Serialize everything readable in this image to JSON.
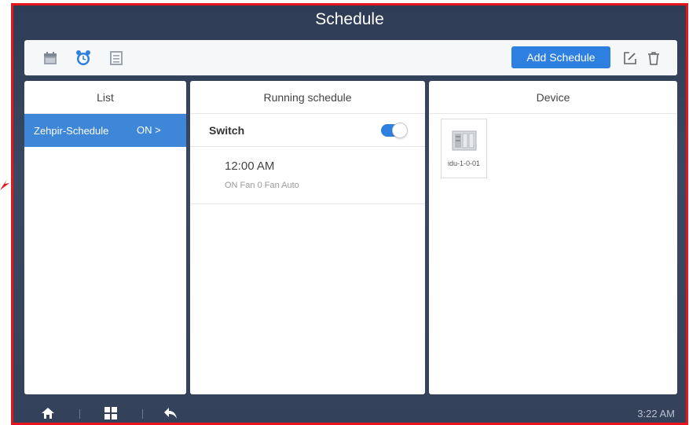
{
  "window": {
    "title": "Schedule"
  },
  "toolbar": {
    "icons": [
      "calendar-icon",
      "alarm-clock-icon",
      "list-icon"
    ],
    "add_schedule_label": "Add Schedule",
    "edit_icon": "edit-icon",
    "delete_icon": "trash-icon"
  },
  "list_panel": {
    "header": "List",
    "items": [
      {
        "name": "Zehpir-Schedule",
        "status": "ON >"
      }
    ]
  },
  "running_panel": {
    "header": "Running schedule",
    "switch_label": "Switch",
    "switch_on": true,
    "entries": [
      {
        "time": "12:00 AM",
        "detail": "ON Fan 0 Fan Auto"
      }
    ]
  },
  "device_panel": {
    "header": "Device",
    "devices": [
      {
        "label": "idu-1-0-01",
        "icon": "indoor-unit-icon"
      }
    ]
  },
  "bottombar": {
    "icons": [
      "home-icon",
      "grid-icon",
      "back-icon"
    ],
    "clock": "3:22 AM"
  },
  "colors": {
    "accent": "#2d7fe0",
    "selected": "#3e86d8",
    "border": "#e8141c",
    "background": "#33415a"
  }
}
